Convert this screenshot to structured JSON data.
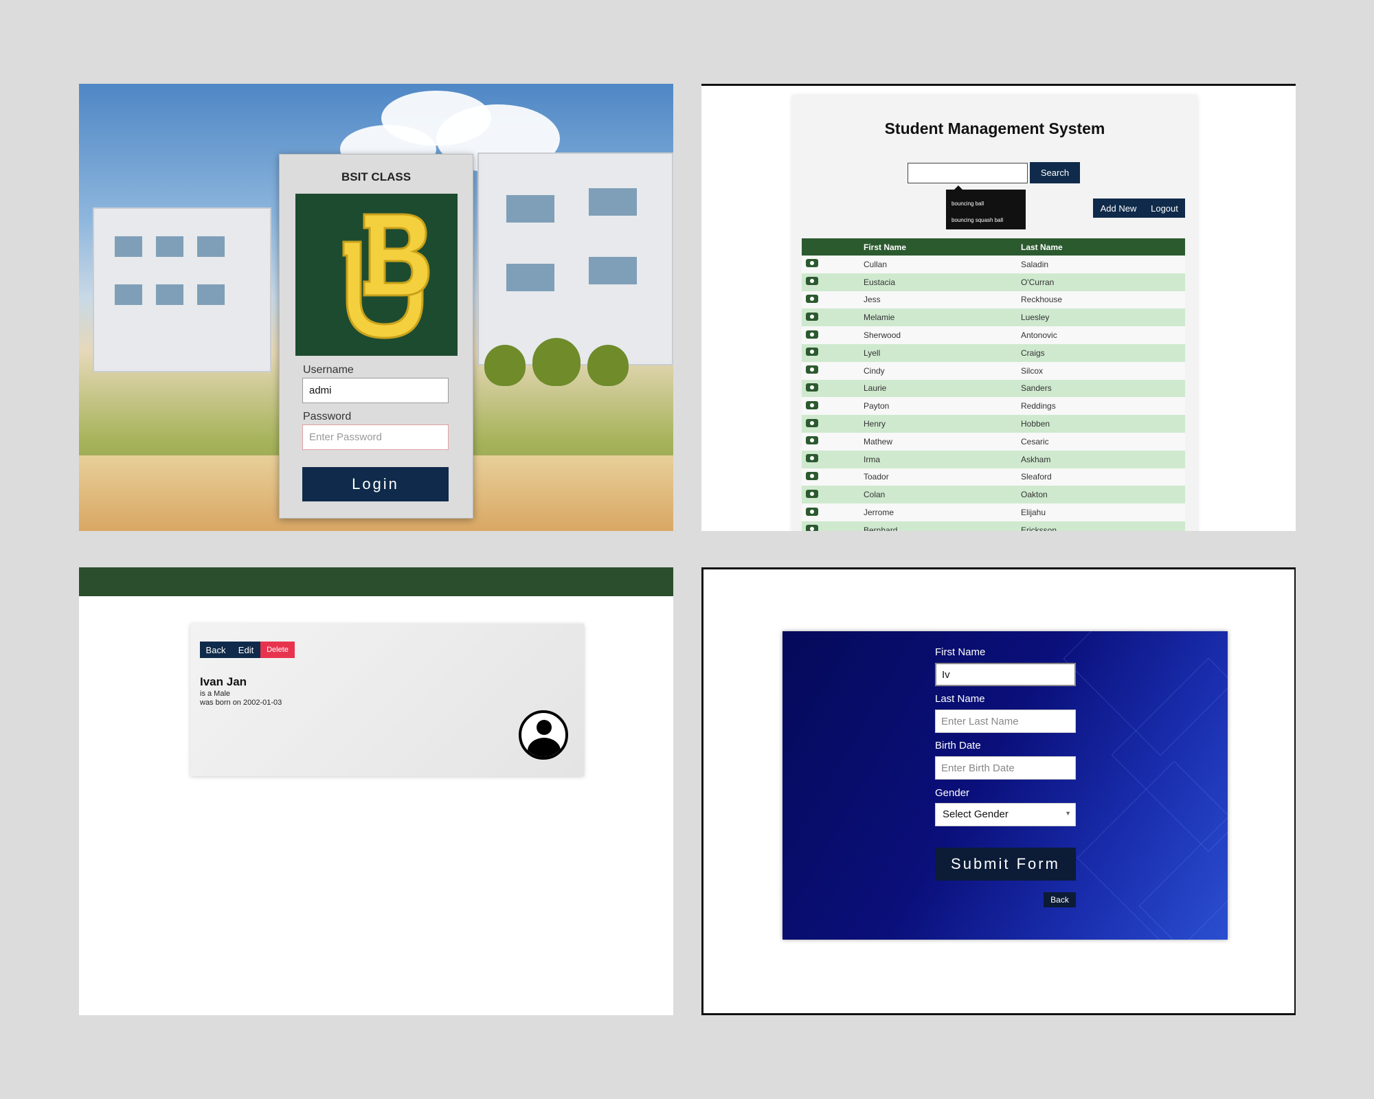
{
  "login": {
    "title": "BSIT CLASS",
    "username_label": "Username",
    "username_value": "admi",
    "password_label": "Password",
    "password_placeholder": "Enter Password",
    "login_button": "Login",
    "logo_colors": {
      "background": "#1d4b30",
      "letters": "#f4d03f"
    }
  },
  "sms": {
    "title": "Student Management System",
    "search_value": "",
    "search_button": "Search",
    "suggestions": [
      "bouncing ball",
      "bouncing squash ball"
    ],
    "add_new_button": "Add New",
    "logout_button": "Logout",
    "columns": [
      "",
      "First Name",
      "Last Name"
    ],
    "rows": [
      {
        "first": "Cullan",
        "last": "Saladin"
      },
      {
        "first": "Eustacia",
        "last": "O'Curran"
      },
      {
        "first": "Jess",
        "last": "Reckhouse"
      },
      {
        "first": "Melamie",
        "last": "Luesley"
      },
      {
        "first": "Sherwood",
        "last": "Antonovic"
      },
      {
        "first": "Lyell",
        "last": "Craigs"
      },
      {
        "first": "Cindy",
        "last": "Silcox"
      },
      {
        "first": "Laurie",
        "last": "Sanders"
      },
      {
        "first": "Payton",
        "last": "Reddings"
      },
      {
        "first": "Henry",
        "last": "Hobben"
      },
      {
        "first": "Mathew",
        "last": "Cesaric"
      },
      {
        "first": "Irma",
        "last": "Askham"
      },
      {
        "first": "Toador",
        "last": "Sleaford"
      },
      {
        "first": "Colan",
        "last": "Oakton"
      },
      {
        "first": "Jerrome",
        "last": "Elijahu"
      },
      {
        "first": "Bernhard",
        "last": "Ericksson"
      }
    ],
    "header_color": "#2c5a2f",
    "stripe_color": "#cfe9cf"
  },
  "detail": {
    "back_button": "Back",
    "edit_button": "Edit",
    "delete_button": "Delete",
    "name": "Ivan Jan",
    "gender_line": "is a Male",
    "birth_line": "was born on 2002-01-03",
    "delete_color": "#e8334f"
  },
  "form": {
    "first_name_label": "First Name",
    "first_name_value": "Iv",
    "last_name_label": "Last Name",
    "last_name_placeholder": "Enter Last Name",
    "birth_date_label": "Birth Date",
    "birth_date_placeholder": "Enter Birth Date",
    "gender_label": "Gender",
    "gender_selected": "Select Gender",
    "submit_button": "Submit Form",
    "back_button": "Back"
  }
}
